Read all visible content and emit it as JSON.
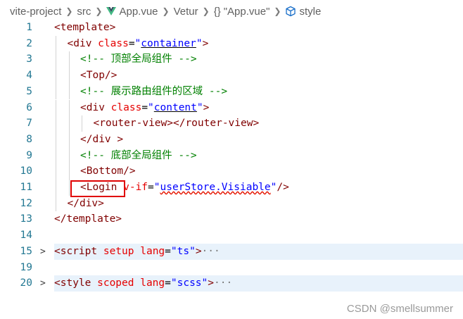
{
  "breadcrumb": {
    "items": [
      "vite-project",
      "src",
      "App.vue",
      "Vetur",
      "\"App.vue\"",
      "style"
    ],
    "braces_glyph": "{}"
  },
  "lines": [
    {
      "n": "1",
      "parts": [
        [
          "t",
          "<template>"
        ]
      ]
    },
    {
      "n": "2",
      "parts": [
        [
          "t",
          "<div "
        ],
        [
          "a",
          "class"
        ],
        [
          "p",
          "="
        ],
        [
          "s",
          "\""
        ],
        [
          "su",
          "container"
        ],
        [
          "s",
          "\""
        ],
        [
          "t",
          ">"
        ]
      ]
    },
    {
      "n": "3",
      "parts": [
        [
          "c",
          "<!-- 顶部全局组件 -->"
        ]
      ]
    },
    {
      "n": "4",
      "parts": [
        [
          "t",
          "<Top/>"
        ]
      ]
    },
    {
      "n": "5",
      "parts": [
        [
          "c",
          "<!-- 展示路由组件的区域 -->"
        ]
      ]
    },
    {
      "n": "6",
      "parts": [
        [
          "t",
          "<div "
        ],
        [
          "a",
          "class"
        ],
        [
          "p",
          "="
        ],
        [
          "s",
          "\""
        ],
        [
          "su",
          "content"
        ],
        [
          "s",
          "\""
        ],
        [
          "t",
          ">"
        ]
      ]
    },
    {
      "n": "7",
      "parts": [
        [
          "t",
          "<router-view></router-view>"
        ]
      ]
    },
    {
      "n": "8",
      "parts": [
        [
          "t",
          "</div >"
        ]
      ]
    },
    {
      "n": "9",
      "parts": [
        [
          "c",
          "<!-- 底部全局组件 -->"
        ]
      ]
    },
    {
      "n": "10",
      "parts": [
        [
          "t",
          "<Bottom/>"
        ]
      ]
    },
    {
      "n": "11",
      "parts": [
        [
          "t",
          "<Login "
        ],
        [
          "a",
          "v-if"
        ],
        [
          "p",
          "="
        ],
        [
          "s",
          "\""
        ],
        [
          "ssq",
          "userStore.Visiable"
        ],
        [
          "s",
          "\""
        ],
        [
          "t",
          "/>"
        ]
      ]
    },
    {
      "n": "12",
      "parts": [
        [
          "t",
          "</div>"
        ]
      ]
    },
    {
      "n": "13",
      "parts": [
        [
          "t",
          "</template>"
        ]
      ]
    },
    {
      "n": "14",
      "parts": []
    },
    {
      "n": "15",
      "parts": [
        [
          "t",
          "<script "
        ],
        [
          "a",
          "setup "
        ],
        [
          "a",
          "lang"
        ],
        [
          "p",
          "="
        ],
        [
          "s",
          "\"ts\""
        ],
        [
          "t",
          ">"
        ],
        [
          "e",
          "···"
        ]
      ]
    },
    {
      "n": "19",
      "parts": []
    },
    {
      "n": "20",
      "parts": [
        [
          "t",
          "<style "
        ],
        [
          "a",
          "scoped "
        ],
        [
          "a",
          "lang"
        ],
        [
          "p",
          "="
        ],
        [
          "s",
          "\"scss\""
        ],
        [
          "t",
          ">"
        ],
        [
          "e",
          "···"
        ]
      ]
    }
  ],
  "folded_lines": [
    "15",
    "20"
  ],
  "fold_glyph": ">",
  "watermark": "CSDN @smellsummer"
}
